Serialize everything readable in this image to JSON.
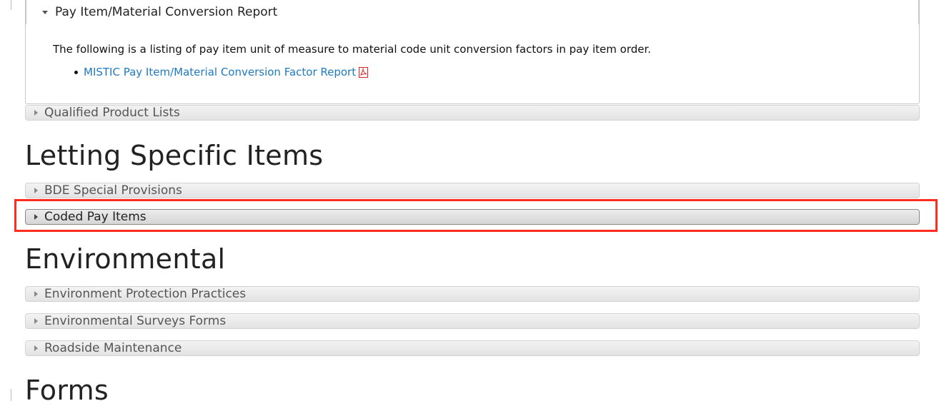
{
  "sections": {
    "pay_item": {
      "header": "Pay Item/Material Conversion Report",
      "description": "The following is a listing of pay item unit of measure to material code unit conversion factors in pay item order.",
      "link": "MISTIC Pay Item/Material Conversion Factor Report"
    },
    "qualified": "Qualified Product Lists",
    "letting": {
      "title": "Letting Specific Items",
      "items": [
        "BDE Special Provisions",
        "Coded Pay Items"
      ]
    },
    "environmental": {
      "title": "Environmental",
      "items": [
        "Environment Protection Practices",
        "Environmental Surveys Forms",
        "Roadside Maintenance"
      ]
    },
    "forms": {
      "title": "Forms"
    }
  }
}
